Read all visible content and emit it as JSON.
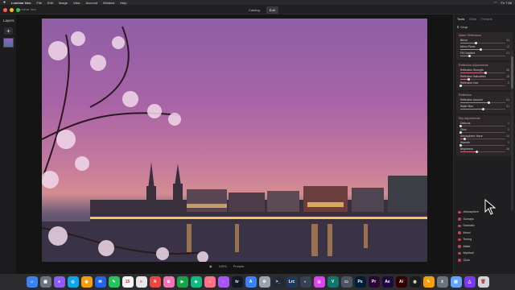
{
  "menubar": {
    "apple": "",
    "items": [
      "Luminar Neo",
      "File",
      "Edit",
      "Image",
      "View",
      "Account",
      "Window",
      "Help"
    ],
    "time": "Fri 7:56"
  },
  "window": {
    "title": "Luminar Neo",
    "modes": [
      "Catalog",
      "Edit"
    ],
    "active_mode": "Edit"
  },
  "sidebar": {
    "title": "Layers",
    "add": "+"
  },
  "canvas": {
    "bottom": [
      "100%",
      "Presets"
    ]
  },
  "panel": {
    "tabs": [
      "Tools",
      "Edits",
      "Presets"
    ],
    "active_tab": "Tools",
    "crop": "Crop",
    "cards": [
      {
        "title": "Water Reflections",
        "sliders": [
          {
            "label": "Blend",
            "value": "34",
            "pct": 0.34
          },
          {
            "label": "Mirror Plane",
            "value": "12",
            "pct": 0.45
          },
          {
            "label": "Fill Gradient",
            "value": "21",
            "pct": 0.21
          }
        ]
      },
      {
        "title": "Reflection Adjustments",
        "sliders": [
          {
            "label": "Reflection Strength",
            "value": "56",
            "pct": 0.56
          },
          {
            "label": "Reflection Saturation",
            "value": "18",
            "pct": 0.18
          },
          {
            "label": "Reflection Hue",
            "value": "0",
            "pct": 0.0
          }
        ]
      },
      {
        "title": "Reflection",
        "sliders": [
          {
            "label": "Reflection Amount",
            "value": "64",
            "pct": 0.64
          },
          {
            "label": "Water Blur",
            "value": "51",
            "pct": 0.51
          }
        ]
      },
      {
        "title": "Sky Adjustments",
        "sliders": [
          {
            "label": "Defocus",
            "value": "0",
            "pct": 0.0
          },
          {
            "label": "Glow",
            "value": "0",
            "pct": 0.0
          },
          {
            "label": "Atmospheric Haze",
            "value": "10",
            "pct": 0.1
          },
          {
            "label": "Warmth",
            "value": "0",
            "pct": 0.0
          },
          {
            "label": "Brightness",
            "value": "36",
            "pct": 0.36
          }
        ]
      }
    ],
    "tools": [
      "Atmosphere",
      "Sunrays",
      "Dramatic",
      "Mood",
      "Toning",
      "Matte",
      "Mystical",
      "Glow"
    ]
  },
  "dock": {
    "icons": [
      {
        "name": "finder-icon",
        "color": "#3b82f6",
        "glyph": "☺"
      },
      {
        "name": "launchpad-icon",
        "color": "#6b7280",
        "glyph": "▦"
      },
      {
        "name": "siri-icon",
        "color": "#8b5cf6",
        "glyph": "●"
      },
      {
        "name": "safari-icon",
        "color": "#0ea5e9",
        "glyph": "◎"
      },
      {
        "name": "chrome-icon",
        "color": "#f59e0b",
        "glyph": "◉"
      },
      {
        "name": "mail-icon",
        "color": "#2563eb",
        "glyph": "✉"
      },
      {
        "name": "messages-icon",
        "color": "#22c55e",
        "glyph": "✎"
      },
      {
        "name": "calendar-icon",
        "color": "#f3f4f6",
        "glyph": "15"
      },
      {
        "name": "reminders-icon",
        "color": "#e5e7eb",
        "glyph": "≡"
      },
      {
        "name": "news-icon",
        "color": "#ef4444",
        "glyph": "N"
      },
      {
        "name": "photos-icon",
        "color": "#f472b6",
        "glyph": "✿"
      },
      {
        "name": "facetime-icon",
        "color": "#16a34a",
        "glyph": "▶"
      },
      {
        "name": "maps-icon",
        "color": "#10b981",
        "glyph": "◆"
      },
      {
        "name": "music-icon",
        "color": "#fb7185",
        "glyph": "♪"
      },
      {
        "name": "podcasts-icon",
        "color": "#a855f7",
        "glyph": "◌"
      },
      {
        "name": "tv-icon",
        "color": "#111827",
        "glyph": "tv"
      },
      {
        "name": "appstore-icon",
        "color": "#3b82f6",
        "glyph": "A"
      },
      {
        "name": "settings-icon",
        "color": "#9ca3af",
        "glyph": "⚙"
      },
      {
        "name": "terminal-icon",
        "color": "#1f2937",
        "glyph": ">_"
      },
      {
        "name": "lightroom-icon",
        "color": "#1e3a5f",
        "glyph": "Lrc"
      },
      {
        "name": "luminar-icon",
        "color": "#374151",
        "glyph": "◐"
      },
      {
        "name": "capture-icon",
        "color": "#d946ef",
        "glyph": "◎"
      },
      {
        "name": "vpn-icon",
        "color": "#0f766e",
        "glyph": "V"
      },
      {
        "name": "screen-icon",
        "color": "#4b5563",
        "glyph": "▭"
      },
      {
        "name": "ps-icon",
        "color": "#001e36",
        "glyph": "Ps"
      },
      {
        "name": "pr-icon",
        "color": "#2a0634",
        "glyph": "Pr"
      },
      {
        "name": "ae-icon",
        "color": "#1f0740",
        "glyph": "Ae"
      },
      {
        "name": "ai-icon",
        "color": "#330000",
        "glyph": "Ai"
      },
      {
        "name": "davinci-icon",
        "color": "#1c1c1c",
        "glyph": "◍"
      },
      {
        "name": "notes-icon",
        "color": "#f59e0b",
        "glyph": "✎"
      },
      {
        "name": "calculator-icon",
        "color": "#6b7280",
        "glyph": "±"
      },
      {
        "name": "preview-icon",
        "color": "#60a5fa",
        "glyph": "▤"
      },
      {
        "name": "affinity-icon",
        "color": "#7c3aed",
        "glyph": "△"
      },
      {
        "name": "trash-icon",
        "color": "#d1d5db",
        "glyph": "🗑"
      }
    ]
  }
}
